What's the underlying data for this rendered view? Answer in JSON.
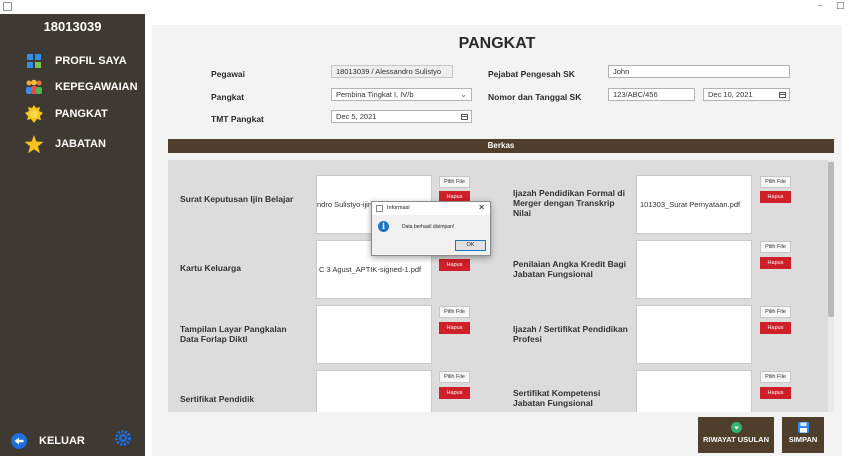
{
  "window": {
    "minimize_glyph": "–",
    "maximize_glyph": "□"
  },
  "sidebar": {
    "user_id": "18013039",
    "items": [
      {
        "label": "PROFIL SAYA",
        "icon": "profile-icon"
      },
      {
        "label": "KEPEGAWAIAN",
        "icon": "people-icon"
      },
      {
        "label": "PANGKAT",
        "icon": "badge-icon"
      },
      {
        "label": "JABATAN",
        "icon": "star-icon"
      }
    ],
    "logout_label": "KELUAR",
    "colors": {
      "background": "#3e3932",
      "logout_icon": "#1b6fe0",
      "settings_icon": "#1b6fe0"
    }
  },
  "page": {
    "title": "PANGKAT"
  },
  "form": {
    "pegawai_label": "Pegawai",
    "pegawai_value": "18013039 / Alessandro Sulistyo",
    "pangkat_label": "Pangkat",
    "pangkat_value": "Pembina Tingkat I, IV/b",
    "tmt_label": "TMT Pangkat",
    "tmt_value": "Dec 5, 2021",
    "pejabat_label": "Pejabat Pengesah SK",
    "pejabat_value": "John",
    "nomor_label": "Nomor dan Tanggal SK",
    "nomor_value": "123/ABC/456",
    "tanggal_value": "Dec 10, 2021"
  },
  "berkas": {
    "header": "Berkas",
    "pick_label": "Pilih File",
    "delete_label": "Hapus",
    "documents": [
      {
        "label": "Surat Keputusan Ijin Belajar",
        "file": "ndro Sulistyo-ijin"
      },
      {
        "label": "Ijazah Pendidikan Formal di Merger dengan Transkrip Nilai",
        "file": "101303_Surat Pernyataan.pdf"
      },
      {
        "label": "Kartu Keluarga",
        "file": "C 3 Agust_APTIK-signed-1.pdf"
      },
      {
        "label": "Penilaian Angka Kredit Bagi Jabatan Fungsional",
        "file": ""
      },
      {
        "label": "Tampilan Layar Pangkalan Data Forlap Dikti",
        "file": ""
      },
      {
        "label": "Ijazah / Sertifikat Pendidikan Profesi",
        "file": ""
      },
      {
        "label": "Sertifikat Pendidik",
        "file": ""
      },
      {
        "label": "Sertifikat Kompetensi Jabatan Fungsional",
        "file": ""
      }
    ]
  },
  "actions": {
    "riwayat_label": "RIWAYAT USULAN",
    "simpan_label": "SIMPAN"
  },
  "dialog": {
    "title": "Informasi",
    "message": "Data berhasil disimpan!",
    "ok_label": "OK",
    "close_glyph": "✕",
    "info_glyph": "i"
  },
  "colors": {
    "accent_brown": "#4f3e2b",
    "delete_red": "#cf1f28",
    "info_blue": "#1f72c8"
  }
}
